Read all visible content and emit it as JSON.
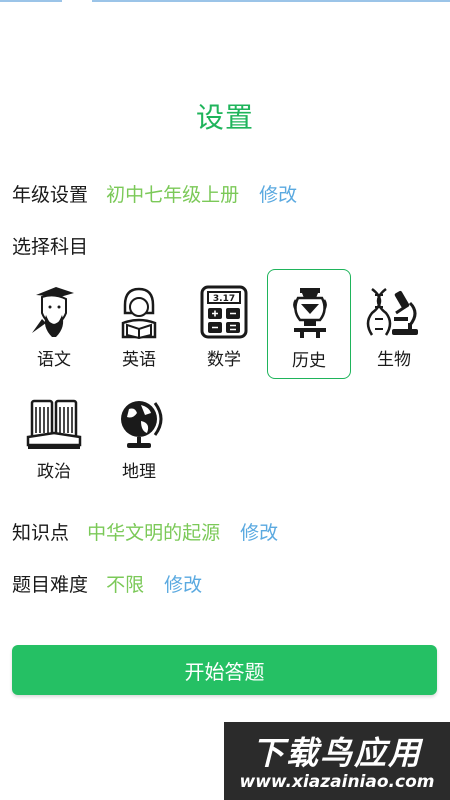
{
  "page": {
    "title": "设置"
  },
  "grade": {
    "label": "年级设置",
    "value": "初中七年级上册",
    "edit": "修改"
  },
  "subjects_section": {
    "label": "选择科目",
    "items": [
      {
        "name": "语文",
        "icon": "poet-icon"
      },
      {
        "name": "英语",
        "icon": "reading-girl-icon"
      },
      {
        "name": "数学",
        "icon": "calculator-icon",
        "display": "3.17"
      },
      {
        "name": "历史",
        "icon": "ancient-vase-icon",
        "selected": true
      },
      {
        "name": "生物",
        "icon": "dna-microscope-icon"
      },
      {
        "name": "政治",
        "icon": "books-icon"
      },
      {
        "name": "地理",
        "icon": "globe-icon"
      }
    ]
  },
  "knowledge": {
    "label": "知识点",
    "value": "中华文明的起源",
    "edit": "修改"
  },
  "difficulty": {
    "label": "题目难度",
    "value": "不限",
    "edit": "修改"
  },
  "start_button": {
    "label": "开始答题"
  },
  "watermark": {
    "line1": "下载鸟应用",
    "line2": "www.xiazainiao.com"
  },
  "colors": {
    "accent": "#1fb45b",
    "value_text": "#7bc958",
    "link": "#5aa9e0",
    "button": "#25c064"
  }
}
